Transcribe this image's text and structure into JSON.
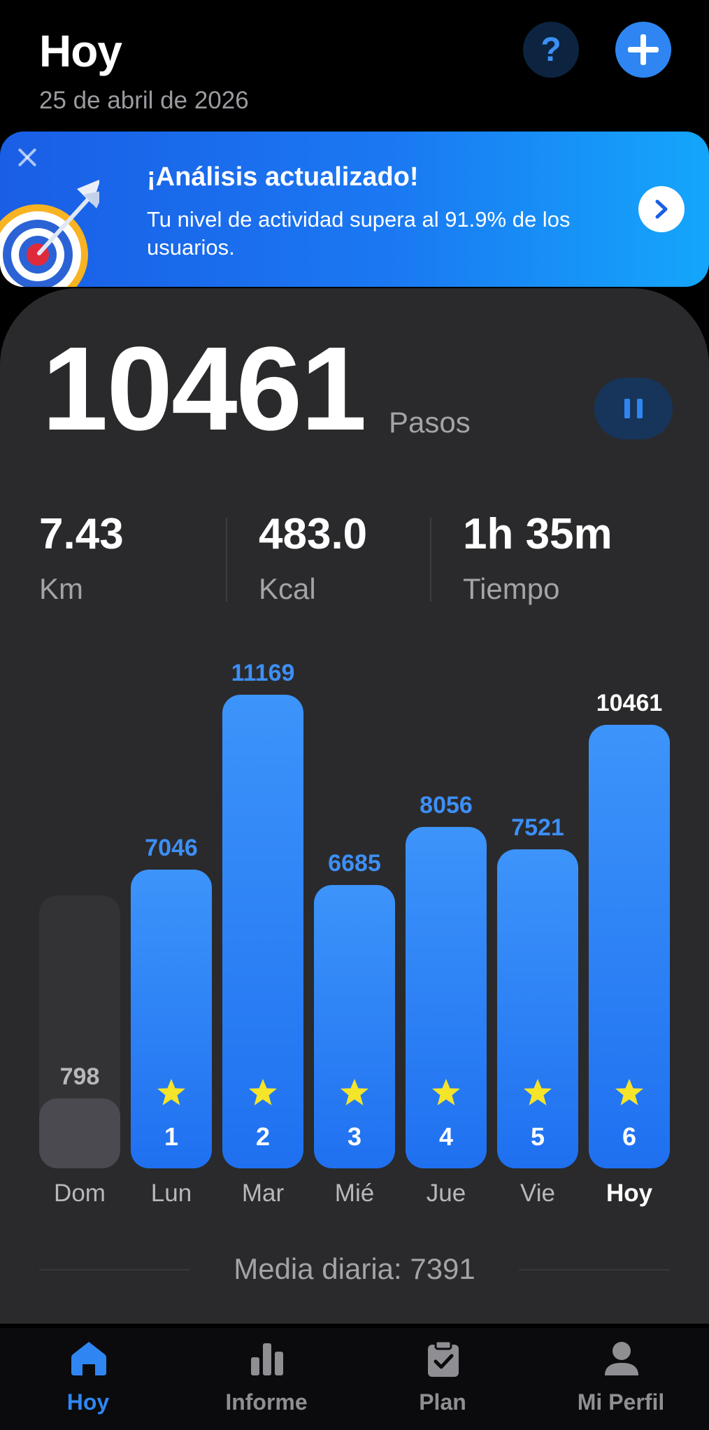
{
  "header": {
    "title": "Hoy",
    "date": "25 de abril de 2026",
    "help_label": "?"
  },
  "banner": {
    "title": "¡Análisis actualizado!",
    "text": "Tu nivel de actividad supera al 91.9% de los usuarios.",
    "icon": "target-arrow-icon"
  },
  "today": {
    "steps": "10461",
    "steps_unit": "Pasos",
    "stats": [
      {
        "value": "7.43",
        "label": "Km"
      },
      {
        "value": "483.0",
        "label": "Kcal"
      },
      {
        "value": "1h 35m",
        "label": "Tiempo"
      }
    ]
  },
  "chart_data": {
    "type": "bar",
    "categories": [
      "Dom",
      "Lun",
      "Mar",
      "Mié",
      "Jue",
      "Vie",
      "Hoy"
    ],
    "values": [
      798,
      7046,
      11169,
      6685,
      8056,
      7521,
      10461
    ],
    "streak_numbers": [
      "",
      "1",
      "2",
      "3",
      "4",
      "5",
      "6"
    ],
    "goal_reached": [
      false,
      true,
      true,
      true,
      true,
      true,
      true
    ],
    "highlight": "Hoy",
    "goal_value": 6000,
    "colors": {
      "achieved": "#2f86f2",
      "not_achieved": "#4a4a50",
      "today_label": "#ffffff",
      "value_label": "#3d8ff6"
    }
  },
  "average": {
    "label": "Media diaria: 7391"
  },
  "nav": {
    "items": [
      {
        "label": "Hoy",
        "icon": "home-icon",
        "active": true
      },
      {
        "label": "Informe",
        "icon": "bar-chart-icon",
        "active": false
      },
      {
        "label": "Plan",
        "icon": "clipboard-check-icon",
        "active": false
      },
      {
        "label": "Mi Perfil",
        "icon": "person-icon",
        "active": false
      }
    ]
  },
  "colors": {
    "accent": "#2f86f2",
    "background": "#000000",
    "card": "#2a2a2c",
    "star": "#f4e42a"
  }
}
